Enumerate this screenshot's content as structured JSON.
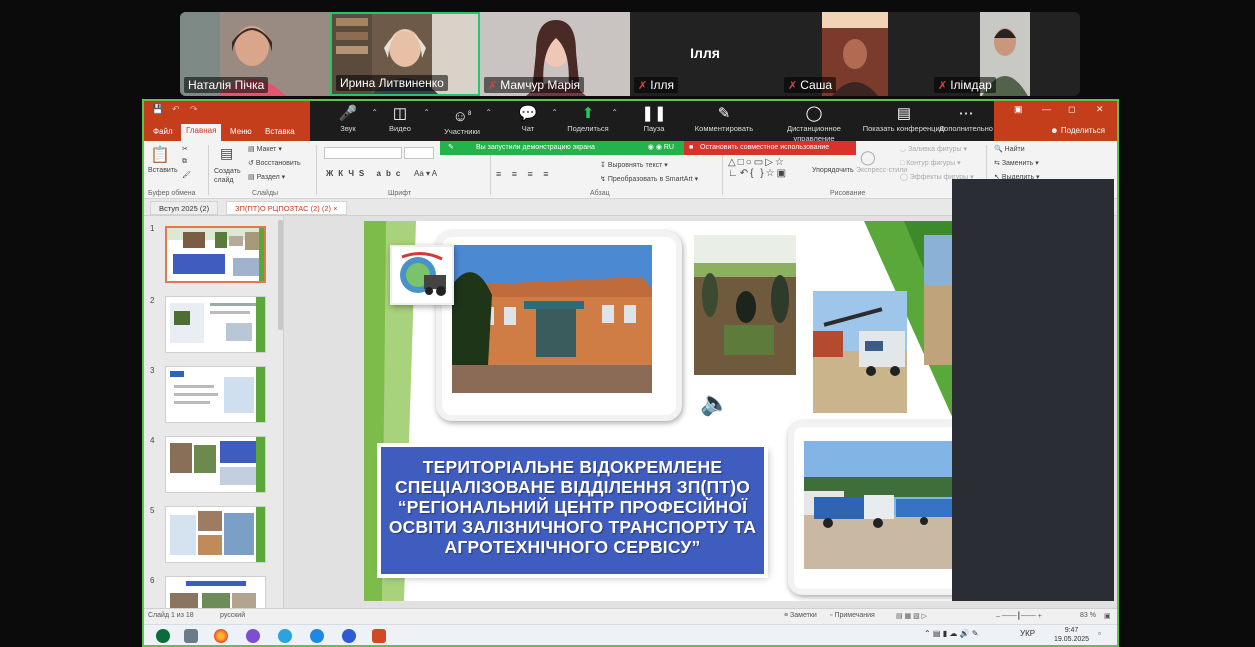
{
  "participants": [
    {
      "name": "Наталія Пічка",
      "muted": false,
      "active": false
    },
    {
      "name": "Ирина Литвиненко",
      "muted": false,
      "active": true
    },
    {
      "name": "Мамчур Марія",
      "muted": true,
      "active": false
    },
    {
      "name": "Ілля",
      "muted": true,
      "active": false,
      "display_name": "Ілля"
    },
    {
      "name": "Саша",
      "muted": true,
      "active": false
    },
    {
      "name": "Ілімдар",
      "muted": true,
      "active": false
    }
  ],
  "zoom_toolbar": {
    "items": [
      {
        "label": "Звук",
        "icon": "microphone-icon"
      },
      {
        "label": "Видео",
        "icon": "video-camera-icon"
      },
      {
        "label": "Участники",
        "icon": "participants-icon",
        "badge": "8"
      },
      {
        "label": "Чат",
        "icon": "chat-icon"
      },
      {
        "label": "Поделиться",
        "icon": "share-screen-icon"
      },
      {
        "label": "Пауза",
        "icon": "pause-icon"
      },
      {
        "label": "Комментировать",
        "icon": "annotate-pen-icon"
      },
      {
        "label": "Дистанционное управление",
        "icon": "mouse-icon"
      },
      {
        "label": "Показать конференцию",
        "icon": "show-meeting-icon"
      },
      {
        "label": "Дополнительно",
        "icon": "more-icon"
      }
    ],
    "share_notice": "Вы запустили демонстрацию экрана",
    "share_lang": "RU",
    "stop_share_label": "Остановить совместное использование"
  },
  "powerpoint": {
    "tabs": [
      "Файл",
      "Главная",
      "Меню",
      "Вставка"
    ],
    "selected_tab": "Главная",
    "share_label": "Поделиться",
    "ribbon": {
      "paste": "Вставить",
      "new_slide": "Создать слайд",
      "layout": "Макет",
      "reset": "Восстановить",
      "section": "Раздел",
      "clipboard_group": "Буфер обмена",
      "slides_group": "Слайды",
      "font_group": "Шрифт",
      "paragraph_group": "Абзац",
      "drawing_group": "Рисование",
      "text_direction": "Выровнять текст",
      "smartart": "Преобразовать в SmartArt",
      "arrange": "Упорядочить",
      "express_styles": "Экспресс-стили",
      "shape_fill": "Заливка фигуры",
      "shape_outline": "Контур фигуры",
      "shape_effects": "Эффекты фигуры",
      "find": "Найти",
      "replace": "Заменить",
      "select": "Выделить"
    },
    "doc_tabs": [
      "Вступ 2025 (2)",
      "ЗП(ПТ)О РЦПОЗТАС (2) (2)"
    ],
    "slide_numbers": [
      "1",
      "2",
      "3",
      "4",
      "5",
      "6"
    ],
    "slide_title": "ТЕРИТОРІАЛЬНЕ ВІДОКРЕМЛЕНЕ СПЕЦІАЛІЗОВАНЕ ВІДДІЛЕННЯ ЗП(ПТ)О “РЕГІОНАЛЬНИЙ ЦЕНТР ПРОФЕСІЙНОЇ ОСВІТИ ЗАЛІЗНИЧНОГО ТРАНСПОРТУ ТА АГРОТЕХНІЧНОГО СЕРВІСУ”",
    "status": {
      "slide_count": "Слайд 1 из 18",
      "language": "русский",
      "notes": "Заметки",
      "comments": "Примечания",
      "zoom": "83 %"
    }
  },
  "taskbar": {
    "keyboard_lang": "УКР",
    "time": "9:47",
    "date": "19.05.2025"
  },
  "colors": {
    "ppt_accent": "#c43e1c",
    "share_border": "#5ec24d",
    "active_speaker": "#21c76a",
    "title_box": "#3f5cbf",
    "slide_green": "#5aa83a"
  }
}
